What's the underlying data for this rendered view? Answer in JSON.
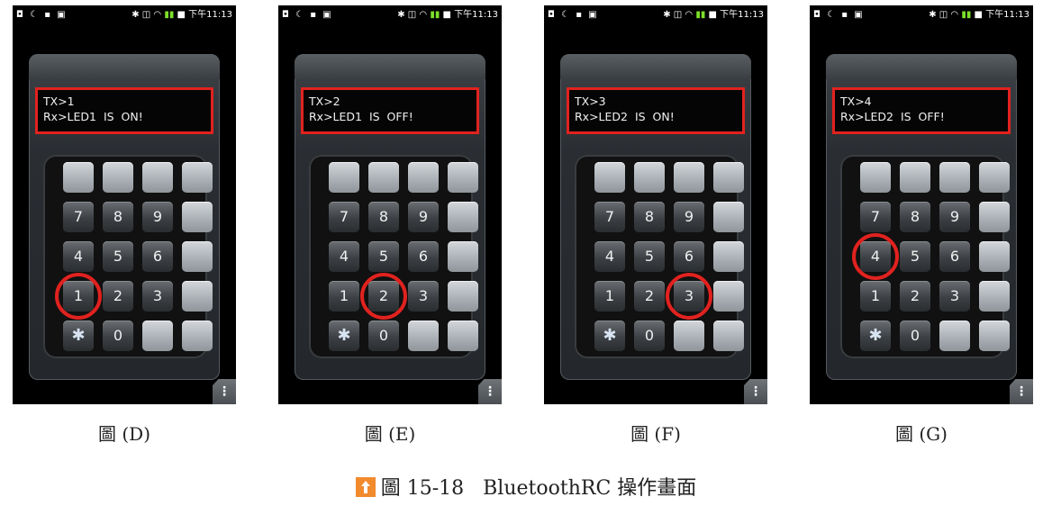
{
  "status_bar": {
    "left_icons": [
      "notification-icon",
      "moon-icon",
      "file-icon",
      "image-icon"
    ],
    "right_icons": [
      "bluetooth-icon",
      "vibrate-icon",
      "wifi-icon",
      "signal-icon",
      "battery-icon"
    ],
    "time": "下午11:13"
  },
  "keypad_keys": [
    "",
    "",
    "",
    "",
    "7",
    "8",
    "9",
    "",
    "4",
    "5",
    "6",
    "",
    "1",
    "2",
    "3",
    "",
    "bluetooth",
    "0",
    "",
    ""
  ],
  "bluetooth_symbol": "✱",
  "menu_symbol": "⋮",
  "panels": [
    {
      "tx": "TX>1",
      "rx": "Rx>LED1  IS  ON!",
      "pressed_key": "1",
      "label": "圖 (D)"
    },
    {
      "tx": "TX>2",
      "rx": "Rx>LED1  IS  OFF!",
      "pressed_key": "2",
      "label": "圖 (E)"
    },
    {
      "tx": "TX>3",
      "rx": "Rx>LED2  IS  ON!",
      "pressed_key": "3",
      "label": "圖 (F)"
    },
    {
      "tx": "TX>4",
      "rx": "Rx>LED2  IS  OFF!",
      "pressed_key": "4",
      "label": "圖 (G)"
    }
  ],
  "caption": {
    "prefix": "圖 15-18",
    "text": "BluetoothRC 操作畫面"
  },
  "colors": {
    "highlight": "#e1221f",
    "caption_icon": "#f28a2e"
  }
}
